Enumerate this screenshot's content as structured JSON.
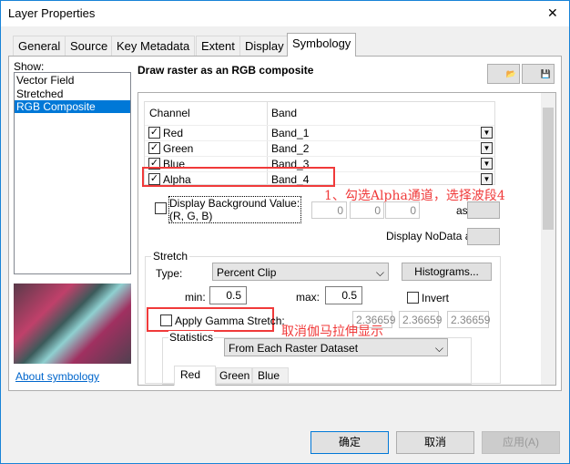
{
  "window": {
    "title": "Layer Properties",
    "close": "✕"
  },
  "tabs": [
    "General",
    "Source",
    "Key Metadata",
    "Extent",
    "Display",
    "Symbology"
  ],
  "show": {
    "label": "Show:",
    "items": [
      "Vector Field",
      "Stretched",
      "RGB Composite"
    ],
    "selected": 2,
    "about": "About symbology"
  },
  "header": "Draw raster as an RGB composite",
  "table": {
    "headers": [
      "Channel",
      "Band"
    ],
    "rows": [
      {
        "channel": "Red",
        "band": "Band_1",
        "checked": true
      },
      {
        "channel": "Green",
        "band": "Band_2",
        "checked": true
      },
      {
        "channel": "Blue",
        "band": "Band_3",
        "checked": true
      },
      {
        "channel": "Alpha",
        "band": "Band_4",
        "checked": true
      }
    ]
  },
  "background": {
    "label": "Display Background Value:(R, G, B)",
    "values": [
      "0",
      "0",
      "0"
    ],
    "as": "as",
    "checked": false
  },
  "nodata": {
    "label": "Display NoData as"
  },
  "stretch": {
    "title": "Stretch",
    "type_label": "Type:",
    "type": "Percent Clip",
    "histograms": "Histograms...",
    "min_label": "min:",
    "min": "0.5",
    "max_label": "max:",
    "max": "0.5",
    "invert": "Invert",
    "gamma_label": "Apply Gamma Stretch:",
    "gamma": [
      "2.36659",
      "2.36659",
      "2.36659"
    ]
  },
  "statistics": {
    "title": "Statistics",
    "value": "From Each Raster Dataset",
    "tabs": [
      "Red",
      "Green",
      "Blue"
    ]
  },
  "annotations": [
    "1、勾选Alpha通道，选择波段4",
    "取消伽马拉伸显示"
  ],
  "buttons": {
    "ok": "确定",
    "cancel": "取消",
    "apply": "应用(A)"
  },
  "colors": {
    "annotation": "#f03a3a",
    "selection": "#0078d7"
  }
}
